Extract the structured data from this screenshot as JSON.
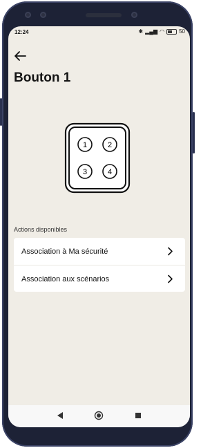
{
  "status_bar": {
    "time": "12:24",
    "battery": "50"
  },
  "header": {
    "title": "Bouton 1"
  },
  "device": {
    "buttons": [
      "1",
      "2",
      "3",
      "4"
    ]
  },
  "actions": {
    "section_label": "Actions disponibles",
    "items": [
      {
        "label": "Association à Ma sécurité"
      },
      {
        "label": "Association aux scénarios"
      }
    ]
  },
  "colors": {
    "background": "#f0ede6",
    "card": "#ffffff",
    "text": "#141414"
  },
  "icons": [
    "back-arrow-icon",
    "chevron-right-icon",
    "bluetooth-icon",
    "signal-icon",
    "wifi-icon",
    "battery-icon"
  ]
}
